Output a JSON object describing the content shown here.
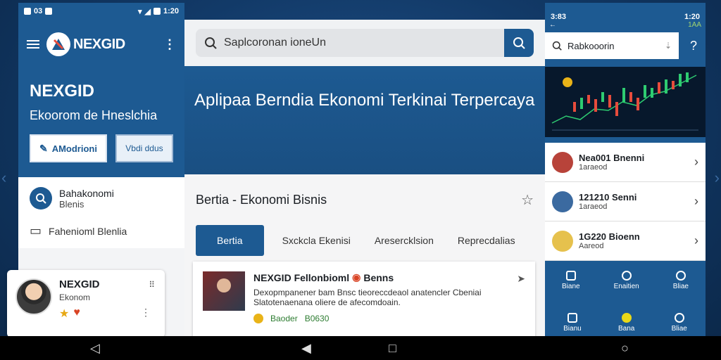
{
  "left_phone": {
    "status_time": "1:20",
    "status_left": "03",
    "brand": "NEXGID",
    "hero_title": "NEXGID",
    "hero_subtitle": "Ekoorom de Hneslchia",
    "btn_primary": "AModrioni",
    "btn_secondary": "Vbdi ddus",
    "menu": [
      {
        "title": "Bahakonomi",
        "sub": "Blenis"
      },
      {
        "title": "Fahenioml Blenlia",
        "sub": ""
      }
    ],
    "profile": {
      "name": "NEXGID",
      "sub": "Ekonom"
    }
  },
  "center": {
    "search_placeholder": "Saplcoronan ioneUn",
    "headline": "Aplipaa Berndia Ekonomi Terkinai Terpercaya",
    "section_title": "Bertia - Ekonomi Bisnis",
    "tabs": [
      "Bertia",
      "Sxckcla Ekenisi",
      "Aresercklsion",
      "Reprecdalias"
    ],
    "article": {
      "title": "NEXGID Fellonbioml",
      "title_suffix": "Benns",
      "body": "Dexopmpanener bam Bnsc tieoreccdeaol anatencler Cbeniai Slatotenaenana oliere de afecomdoain.",
      "meta_label": "Baoder",
      "meta_value": "B0630"
    }
  },
  "right_phone": {
    "status_time": "1:20",
    "status_left": "3:83",
    "top_label": "1AA",
    "search_text": "Rabkooorin",
    "items": [
      {
        "title": "Nea001 Bnenni",
        "sub": "1araeod"
      },
      {
        "title": "121210 Senni",
        "sub": "1araeod"
      },
      {
        "title": "1G220 Bioenn",
        "sub": "Aareod"
      }
    ],
    "nav_labels": [
      "Biane",
      "Enaitien",
      "Bliae"
    ],
    "nav_labels2": [
      "Bianu",
      "Bana",
      "Bliae"
    ]
  },
  "colors": {
    "primary": "#1d5a92",
    "background": "#123a68",
    "chart_up": "#2ecc71",
    "chart_down": "#e74c3c",
    "accent": "#e9b318"
  },
  "icons": {
    "menu": "hamburger-icon",
    "search": "search-icon",
    "star": "star-icon",
    "share": "share-icon",
    "chevron": "chevron-right-icon",
    "chat": "chat-icon"
  }
}
